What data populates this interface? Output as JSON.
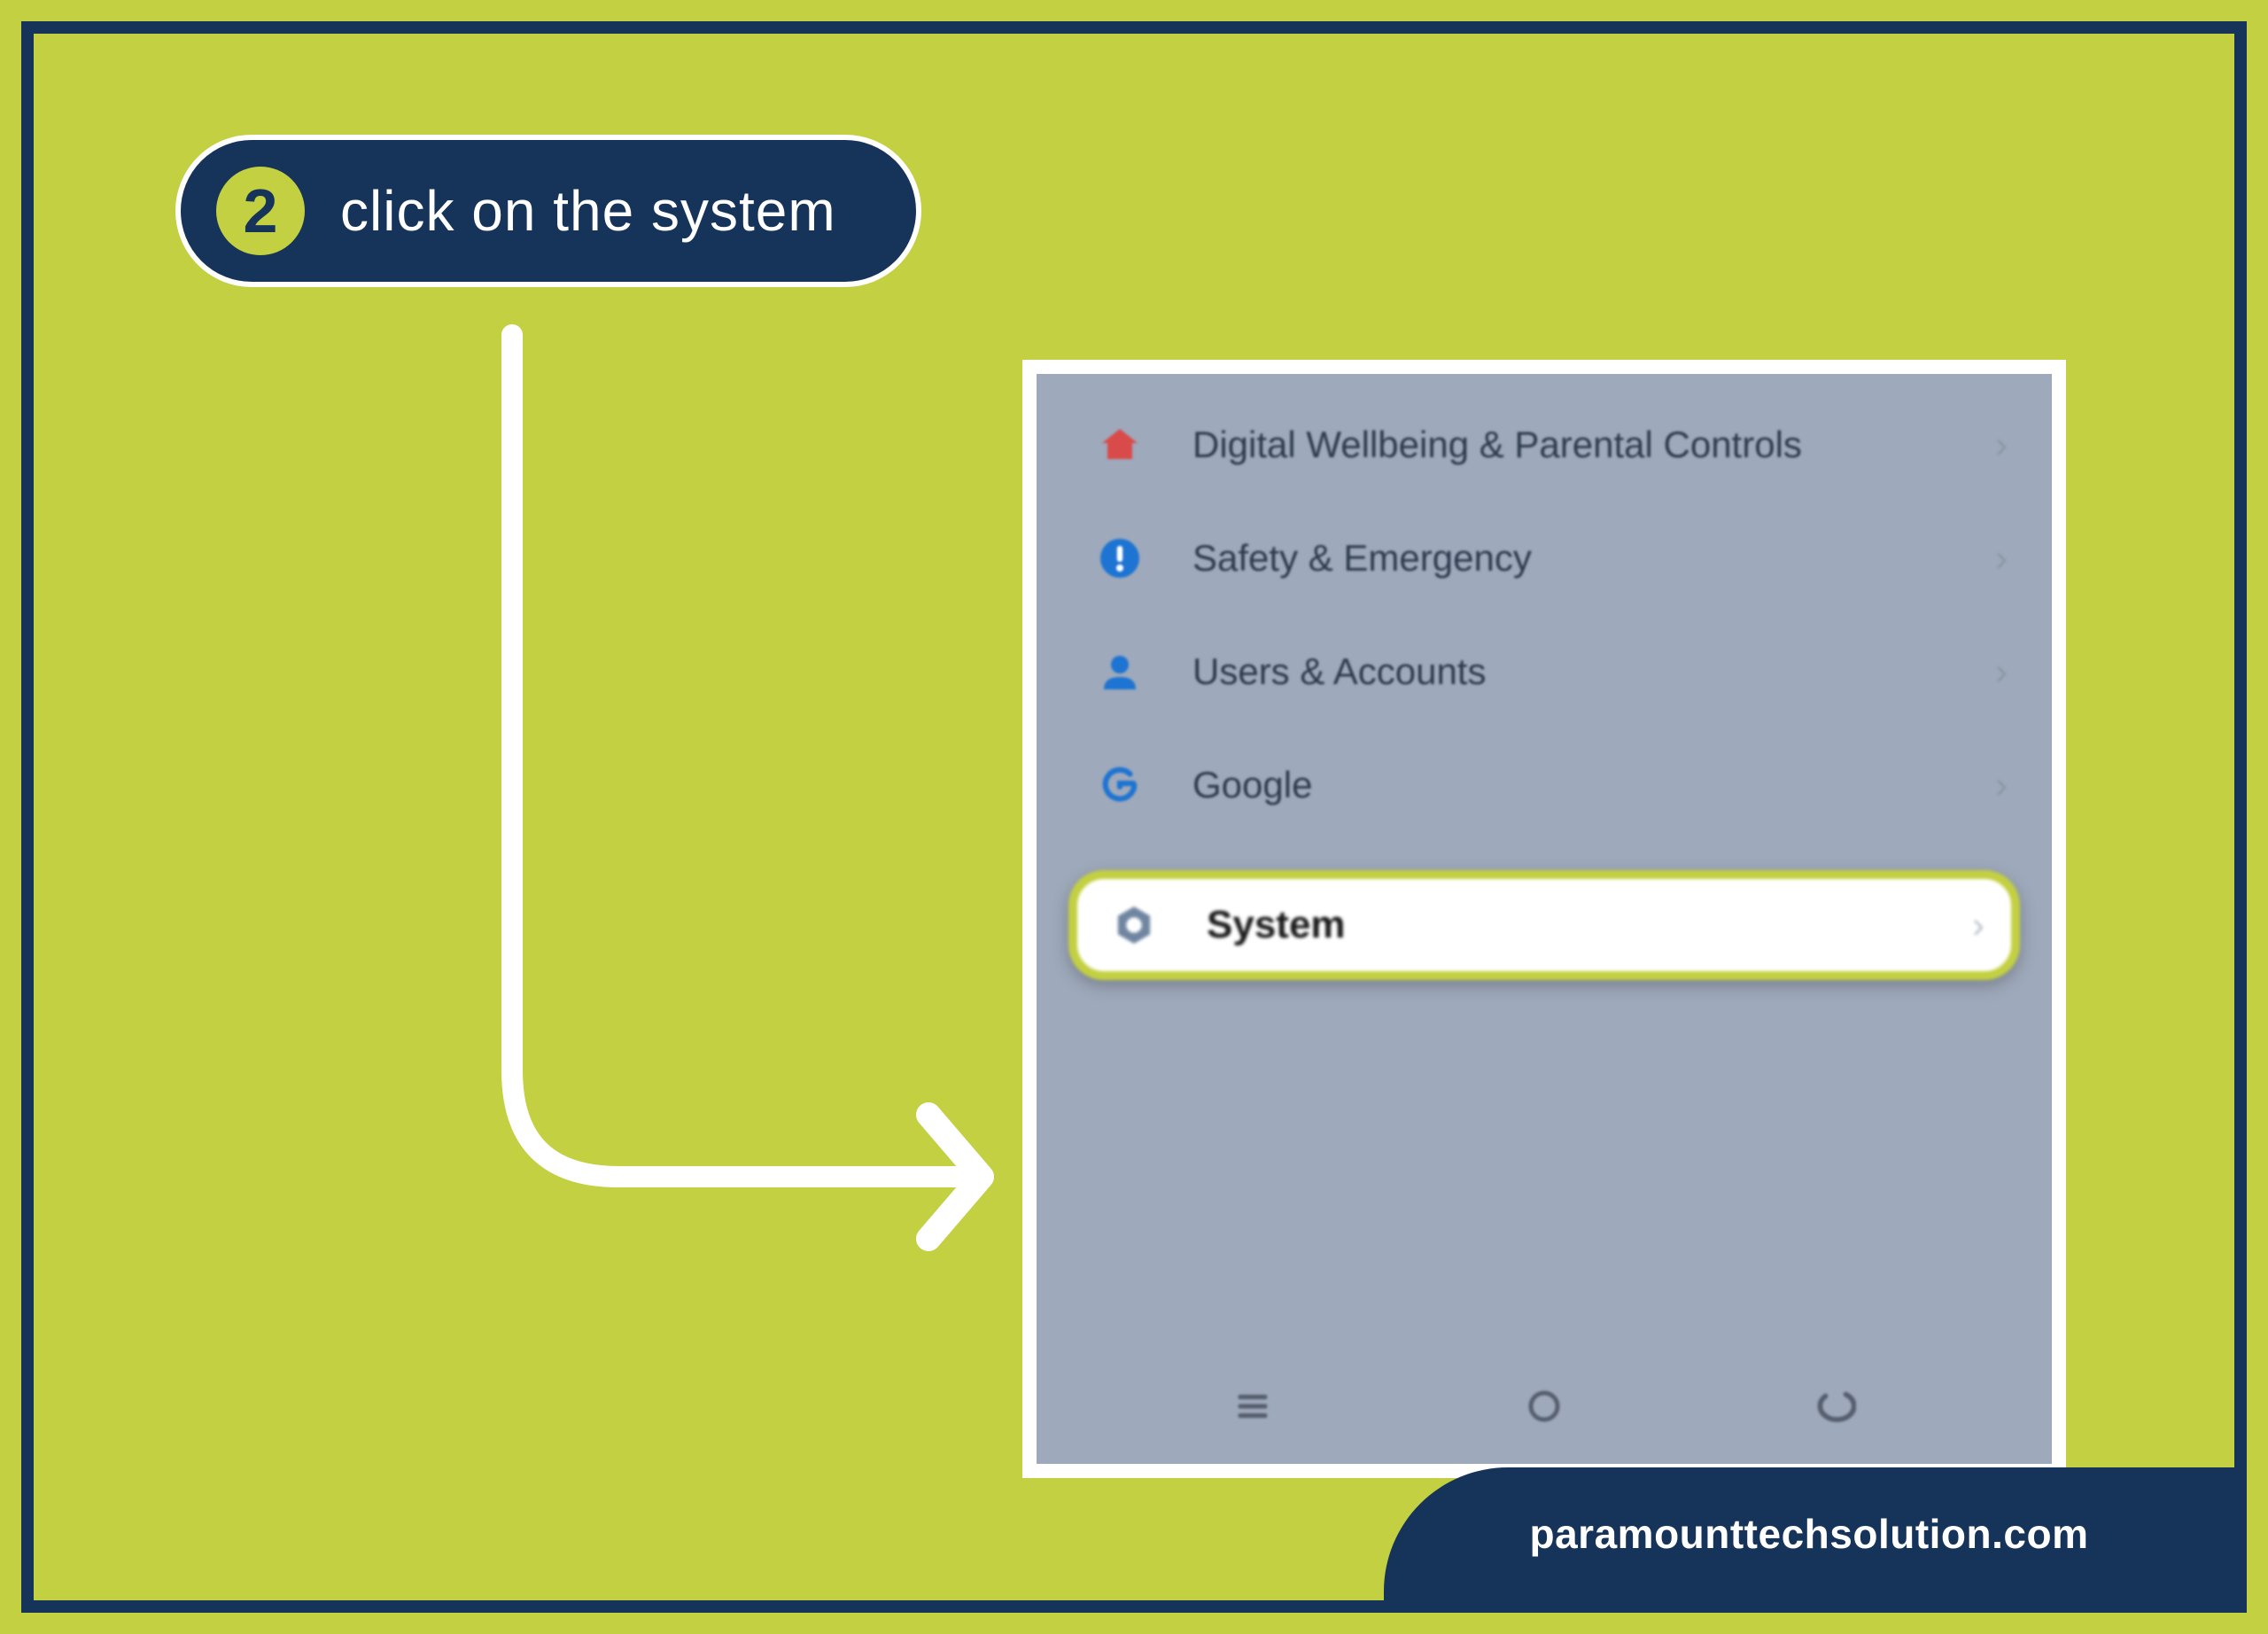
{
  "step": {
    "number": "2",
    "instruction": "click on the system"
  },
  "settings": {
    "items": [
      {
        "label": "Digital Wellbeing & Parental Controls",
        "icon": "house-icon",
        "color": "#d94a4a"
      },
      {
        "label": "Safety & Emergency",
        "icon": "alert-icon",
        "color": "#1e74d2"
      },
      {
        "label": "Users & Accounts",
        "icon": "person-icon",
        "color": "#1e74d2"
      },
      {
        "label": "Google",
        "icon": "google-g-icon",
        "color": "#1e74d2"
      }
    ],
    "highlighted": {
      "label": "System",
      "icon": "gear-icon",
      "color": "#6f85a0"
    }
  },
  "watermark": "paramounttechsolution.com",
  "colors": {
    "accent": "#c3d041",
    "brand": "#16335a"
  }
}
